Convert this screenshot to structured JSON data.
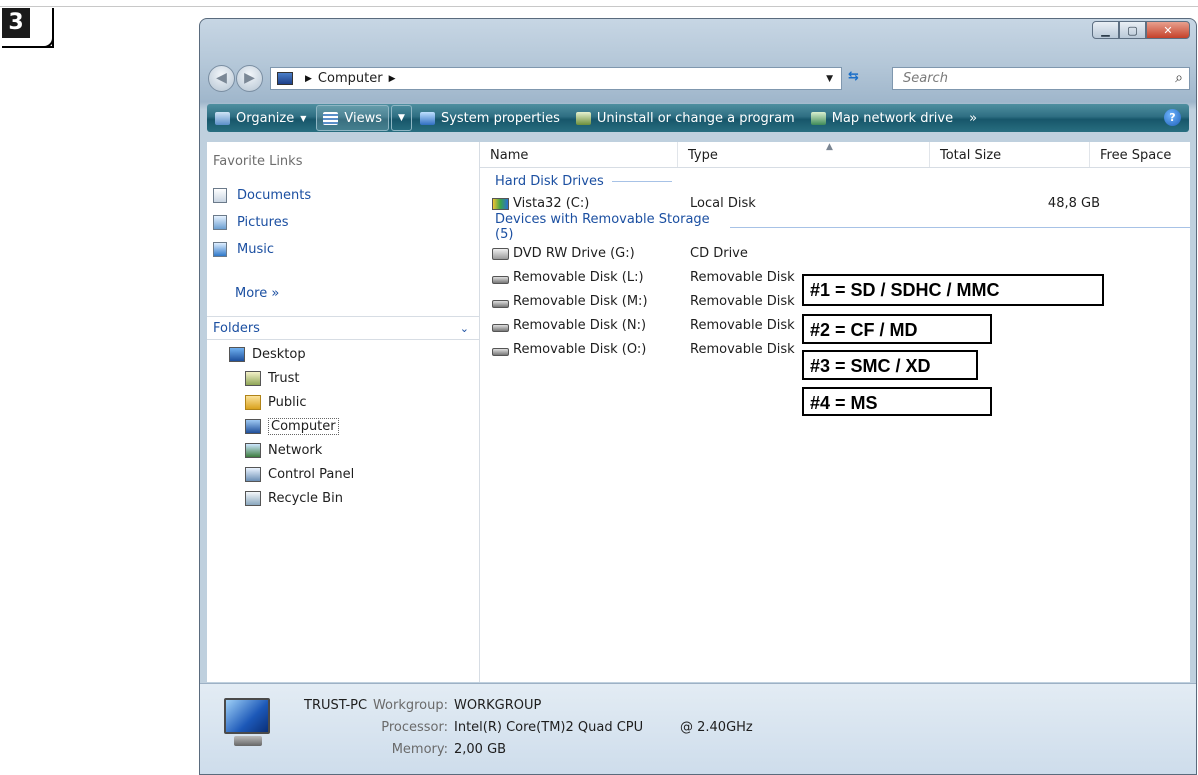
{
  "step": {
    "number": "3"
  },
  "address": {
    "location": "Computer",
    "search_placeholder": "Search"
  },
  "toolbar": {
    "organize": "Organize",
    "views": "Views",
    "system_properties": "System properties",
    "uninstall": "Uninstall or change a program",
    "map_drive": "Map network drive",
    "overflow": "»",
    "help": "?"
  },
  "nav": {
    "favorites_heading": "Favorite Links",
    "favorites": [
      {
        "label": "Documents",
        "icon": "documents-icon"
      },
      {
        "label": "Pictures",
        "icon": "pictures-icon"
      },
      {
        "label": "Music",
        "icon": "music-icon"
      }
    ],
    "more": "More »",
    "folders_heading": "Folders",
    "tree": [
      {
        "label": "Desktop",
        "icon": "desktop-icon"
      },
      {
        "label": "Trust",
        "icon": "user-folder-icon"
      },
      {
        "label": "Public",
        "icon": "folder-icon"
      },
      {
        "label": "Computer",
        "icon": "computer-icon"
      },
      {
        "label": "Network",
        "icon": "network-icon"
      },
      {
        "label": "Control Panel",
        "icon": "control-panel-icon"
      },
      {
        "label": "Recycle Bin",
        "icon": "recycle-bin-icon"
      }
    ]
  },
  "columns": {
    "name": "Name",
    "type": "Type",
    "total_size": "Total Size",
    "free_space": "Free Space"
  },
  "groups": {
    "hard_disks": "Hard Disk Drives",
    "removable": "Devices with Removable Storage (5)"
  },
  "drives": [
    {
      "name": "Vista32 (C:)",
      "type": "Local Disk",
      "size": "48,8 GB",
      "icon": "hard-disk-icon"
    },
    {
      "name": "DVD RW Drive (G:)",
      "type": "CD Drive",
      "size": "",
      "icon": "dvd-drive-icon"
    },
    {
      "name": "Removable Disk (L:)",
      "type": "Removable Disk",
      "size": "",
      "icon": "removable-disk-icon"
    },
    {
      "name": "Removable Disk (M:)",
      "type": "Removable Disk",
      "size": "",
      "icon": "removable-disk-icon"
    },
    {
      "name": "Removable Disk (N:)",
      "type": "Removable Disk",
      "size": "",
      "icon": "removable-disk-icon"
    },
    {
      "name": "Removable Disk (O:)",
      "type": "Removable Disk",
      "size": "",
      "icon": "removable-disk-icon"
    }
  ],
  "callouts": [
    "#1 = SD / SDHC / MMC",
    "#2 = CF / MD",
    "#3 = SMC / XD",
    "#4 = MS"
  ],
  "details": {
    "computer_name": "TRUST-PC",
    "workgroup_label": "Workgroup:",
    "workgroup": "WORKGROUP",
    "processor_label": "Processor:",
    "processor": "Intel(R) Core(TM)2 Quad CPU",
    "processor_speed": "@ 2.40GHz",
    "memory_label": "Memory:",
    "memory": "2,00 GB"
  }
}
